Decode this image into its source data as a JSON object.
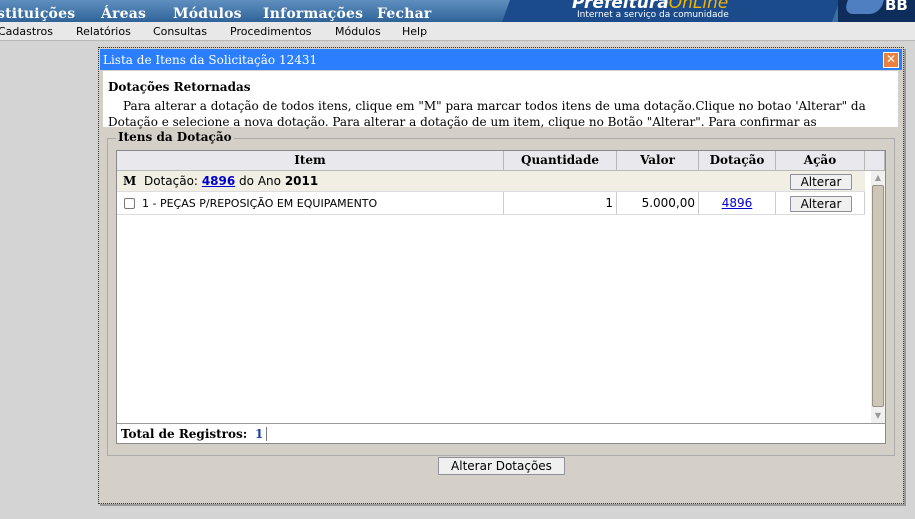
{
  "top_menu": {
    "items": [
      "stituições",
      "Áreas",
      "Módulos",
      "Informações",
      "Fechar"
    ]
  },
  "brand": {
    "title_main": "Prefeitura",
    "title_accent": "OnLine",
    "subtitle": "Internet a serviço da comunidade",
    "right_logo": "BB"
  },
  "menu_bar": {
    "items": [
      "Cadastros",
      "Relatórios",
      "Consultas",
      "Procedimentos",
      "Módulos",
      "Help"
    ]
  },
  "modal": {
    "title": "Lista de Itens da Solicitação 12431",
    "close_symbol": "✕",
    "heading": "Dotações Retornadas",
    "instructions": "Para alterar a dotação de todos itens, clique em \"M\" para marcar todos itens de uma dotação.Clique no botao 'Alterar\" da Dotação e selecione a nova dotação. Para alterar a dotação de um item, clique no Botão \"Alterar\". Para confirmar as",
    "section_title": "Itens da Dotação",
    "columns": [
      "Item",
      "Quantidade",
      "Valor",
      "Dotação",
      "Ação"
    ],
    "group": {
      "marker": "M",
      "prefix": "Dotação:",
      "dotacao": "4896",
      "middle": "do Ano",
      "year": "2011",
      "action": "Alterar"
    },
    "rows": [
      {
        "item": "1 - PEÇAS P/REPOSIÇÃO EM EQUIPAMENTO",
        "quantidade": "1",
        "valor": "5.000,00",
        "dotacao": "4896",
        "action": "Alterar"
      }
    ],
    "total_label": "Total de Registros:",
    "total_value": "1",
    "submit_label": "Alterar Dotações"
  }
}
